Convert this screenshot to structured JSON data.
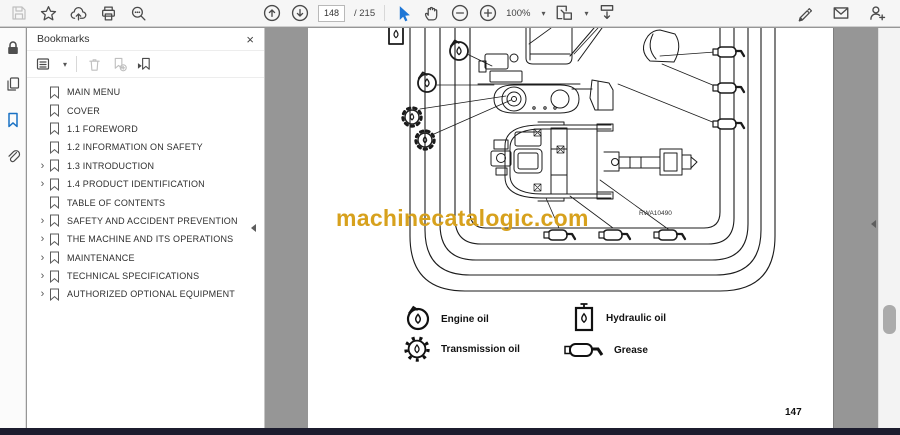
{
  "toolbar": {
    "page_current": "148",
    "page_total": "/ 215",
    "zoom_level": "100%"
  },
  "glyphs": {
    "close": "×",
    "caret": "▾",
    "chevron": "›"
  },
  "sidebar": {
    "panel_title": "Bookmarks"
  },
  "bookmarks": [
    {
      "label": "MAIN MENU",
      "expandable": false
    },
    {
      "label": "COVER",
      "expandable": false
    },
    {
      "label": "1.1 FOREWORD",
      "expandable": false
    },
    {
      "label": "1.2 INFORMATION ON SAFETY",
      "expandable": false
    },
    {
      "label": "1.3 INTRODUCTION",
      "expandable": true
    },
    {
      "label": "1.4 PRODUCT IDENTIFICATION",
      "expandable": true
    },
    {
      "label": "TABLE OF CONTENTS",
      "expandable": false
    },
    {
      "label": "SAFETY AND ACCIDENT PREVENTION",
      "expandable": true
    },
    {
      "label": "THE MACHINE AND ITS OPERATIONS",
      "expandable": true
    },
    {
      "label": "MAINTENANCE",
      "expandable": true
    },
    {
      "label": "TECHNICAL SPECIFICATIONS",
      "expandable": true
    },
    {
      "label": "AUTHORIZED OPTIONAL EQUIPMENT",
      "expandable": true
    }
  ],
  "page": {
    "watermark": "machinecatalogic.com",
    "figure_code": "RWA10490",
    "page_number": "147",
    "legend": {
      "engine": "Engine oil",
      "hydraulic": "Hydraulic oil",
      "transmission": "Transmission oil",
      "grease": "Grease"
    }
  },
  "colors": {
    "accent_blue": "#1e76d6",
    "bookmark_active": "#1a72c4",
    "watermark_gold": "#d7a11d",
    "doc_background": "#969696",
    "bottom_bar": "#1c1c2e"
  }
}
